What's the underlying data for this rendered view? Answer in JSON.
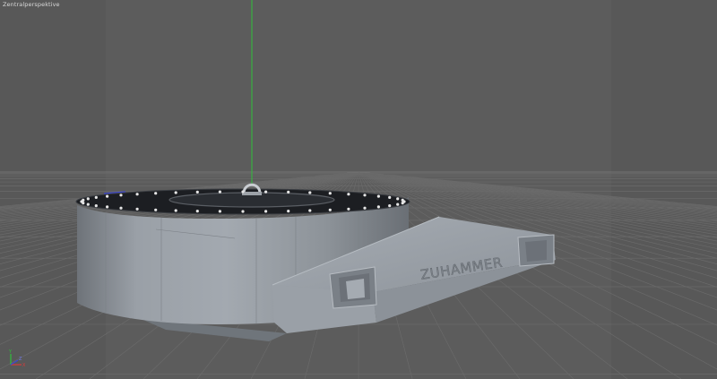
{
  "viewport": {
    "view_label": "Zentralperspektive",
    "background_color": "#5c5c5c",
    "grid_color": "#6b6b6b",
    "horizon_color": "#727272",
    "y_axis_color": "#2fbf3a",
    "x_axis_color": "#3b46d6"
  },
  "scene": {
    "model": {
      "engraved_text": "ZUHAMMER",
      "body_color": "#8c929a",
      "top_color": "#1c1e22",
      "rivet_color": "#e6e6e6"
    }
  },
  "gizmo": {
    "x_label": "X",
    "y_label": "Y",
    "z_label": "Z"
  }
}
